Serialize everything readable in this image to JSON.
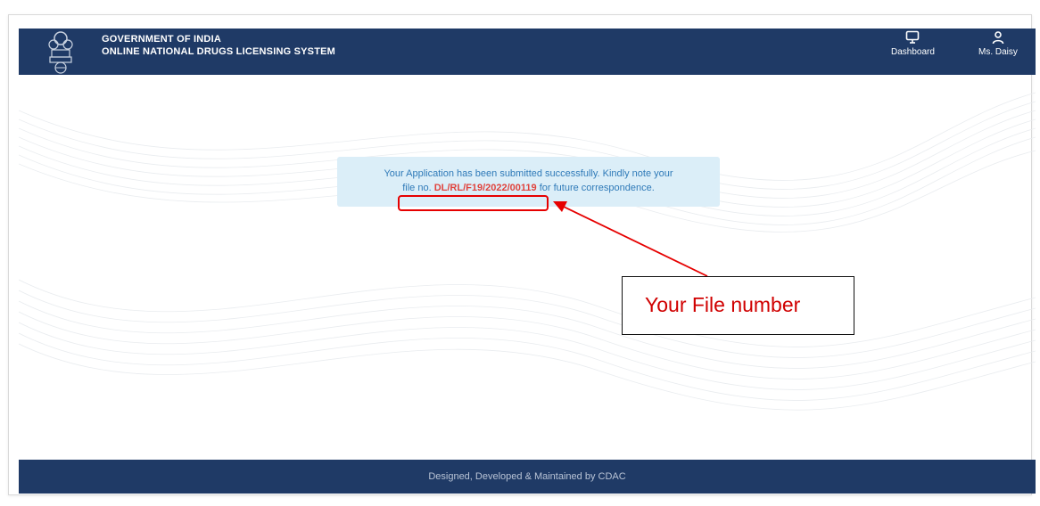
{
  "header": {
    "title_line1": "GOVERNMENT OF INDIA",
    "title_line2": "ONLINE NATIONAL DRUGS LICENSING SYSTEM",
    "dashboard_label": "Dashboard",
    "user_label": "Ms. Daisy"
  },
  "alert": {
    "text_line1": "Your Application has been submitted successfully. Kindly note your",
    "text_prefix": "file no.",
    "file_number": "DL/RL/F19/2022/00119",
    "text_suffix": "for future correspondence."
  },
  "annotation": {
    "callout_text": "Your File number"
  },
  "footer": {
    "text": "Designed, Developed & Maintained by CDAC"
  },
  "colors": {
    "header_bg": "#1f3a66",
    "alert_bg": "#dbeef8",
    "alert_text": "#2f7ab8",
    "file_number": "#e0443e",
    "annotation": "#e60000"
  }
}
